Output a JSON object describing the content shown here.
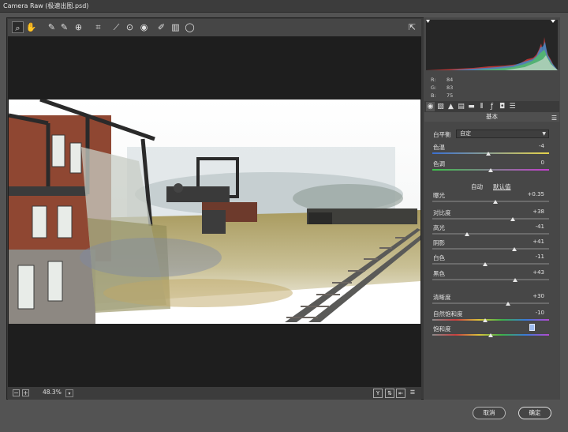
{
  "window": {
    "title": "Camera Raw (极速出图.psd)"
  },
  "toolbar": {
    "tools": [
      {
        "icon": "zoom-icon",
        "glyph": "⌕"
      },
      {
        "icon": "hand-icon",
        "glyph": "✋"
      },
      {
        "icon": "white-balance-icon",
        "glyph": "✎"
      },
      {
        "icon": "color-sampler-icon",
        "glyph": "✎"
      },
      {
        "icon": "targeted-adjustment-icon",
        "glyph": "⊕"
      },
      {
        "icon": "crop-icon",
        "glyph": "⌗"
      },
      {
        "icon": "straighten-icon",
        "glyph": "⟋"
      },
      {
        "icon": "spot-removal-icon",
        "glyph": "⊙"
      },
      {
        "icon": "red-eye-icon",
        "glyph": "◉"
      },
      {
        "icon": "adjustment-brush-icon",
        "glyph": "✐"
      },
      {
        "icon": "graduated-filter-icon",
        "glyph": "▥"
      },
      {
        "icon": "radial-filter-icon",
        "glyph": "◯"
      }
    ],
    "export_icon": "open-preferences-icon"
  },
  "bottombar": {
    "zoom_value": "48.3%"
  },
  "histogram": {
    "r_label": "R:",
    "g_label": "G:",
    "b_label": "B:",
    "r": "84",
    "g": "83",
    "b": "75"
  },
  "panel": {
    "section_title": "基本",
    "white_balance": {
      "label": "白平衡",
      "value": "自定"
    },
    "auto_link": "自动",
    "default_link": "默认值",
    "sliders": [
      {
        "id": "temperature",
        "label": "色温",
        "value": "-4",
        "level": 0.48
      },
      {
        "id": "tint",
        "label": "色调",
        "value": "0",
        "level": 0.5
      },
      {
        "id": "exposure",
        "label": "曝光",
        "value": "+0.35",
        "level": 0.54
      },
      {
        "id": "contrast",
        "label": "对比度",
        "value": "+38",
        "level": 0.69
      },
      {
        "id": "highlights",
        "label": "高光",
        "value": "-41",
        "level": 0.3
      },
      {
        "id": "shadows",
        "label": "阴影",
        "value": "+41",
        "level": 0.7
      },
      {
        "id": "whites",
        "label": "白色",
        "value": "-11",
        "level": 0.45
      },
      {
        "id": "blacks",
        "label": "黑色",
        "value": "+43",
        "level": 0.71
      },
      {
        "id": "clarity",
        "label": "清晰度",
        "value": "+30",
        "level": 0.65
      },
      {
        "id": "vibrance",
        "label": "自然饱和度",
        "value": "-10",
        "level": 0.45
      },
      {
        "id": "saturation",
        "label": "饱和度",
        "value": "0",
        "level": 0.5
      }
    ]
  },
  "footer": {
    "cancel": "取消",
    "ok": "确定"
  },
  "colors": {
    "panel_bg": "#474747",
    "preview_bg": "#1e1e1e",
    "accent_selection": "#9ebcf0"
  }
}
